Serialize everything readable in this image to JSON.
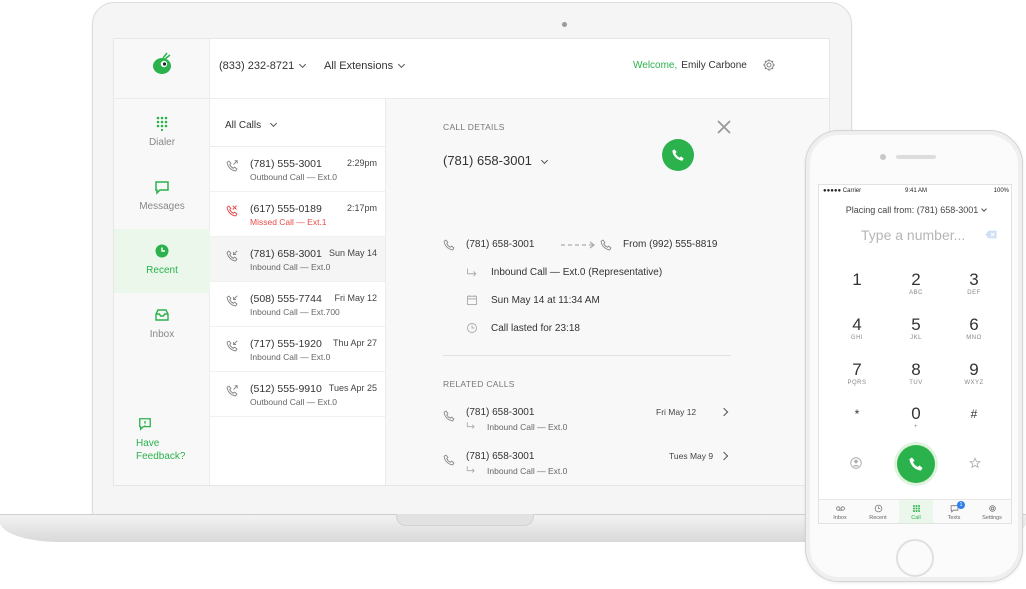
{
  "topbar": {
    "phone_number": "(833) 232-8721",
    "extensions": "All Extensions",
    "welcome": "Welcome,",
    "user": "Emily Carbone"
  },
  "nav": {
    "items": [
      {
        "label": "Dialer"
      },
      {
        "label": "Messages"
      },
      {
        "label": "Recent"
      },
      {
        "label": "Inbox"
      }
    ],
    "feedback_line1": "Have",
    "feedback_line2": "Feedback?"
  },
  "list": {
    "filter": "All Calls",
    "calls": [
      {
        "number": "(781) 555-3001",
        "date": "2:29pm",
        "sub": "Outbound Call — Ext.0",
        "type": "outbound"
      },
      {
        "number": "(617) 555-0189",
        "date": "2:17pm",
        "sub": "Missed Call — Ext.1",
        "type": "missed"
      },
      {
        "number": "(781) 658-3001",
        "date": "Sun May 14",
        "sub": "Inbound Call — Ext.0",
        "type": "inbound"
      },
      {
        "number": "(508) 555-7744",
        "date": "Fri May 12",
        "sub": "Inbound Call — Ext.700",
        "type": "inbound"
      },
      {
        "number": "(717) 555-1920",
        "date": "Thu Apr 27",
        "sub": "Inbound Call — Ext.0",
        "type": "inbound"
      },
      {
        "number": "(512) 555-9910",
        "date": "Tues Apr 25",
        "sub": "Outbound Call — Ext.0",
        "type": "outbound"
      }
    ]
  },
  "detail": {
    "label": "CALL DETAILS",
    "number": "(781) 658-3001",
    "from_number": "(781) 658-3001",
    "from_label": "From (992) 555-8819",
    "route": "Inbound Call — Ext.0 (Representative)",
    "datetime": "Sun May 14 at 11:34 AM",
    "duration": "Call lasted for 23:18",
    "related_label": "RELATED CALLS",
    "related": [
      {
        "number": "(781) 658-3001",
        "sub": "Inbound Call — Ext.0",
        "date": "Fri May 12"
      },
      {
        "number": "(781) 658-3001",
        "sub": "Inbound Call — Ext.0",
        "date": "Tues May 9"
      }
    ]
  },
  "phone": {
    "carrier": "●●●●● Carrier",
    "time": "9:41 AM",
    "battery": "100%",
    "placing": "Placing call from: (781) 658-3001",
    "placeholder": "Type a number...",
    "keys": [
      {
        "d": "1",
        "l": ""
      },
      {
        "d": "2",
        "l": "ABC"
      },
      {
        "d": "3",
        "l": "DEF"
      },
      {
        "d": "4",
        "l": "GHI"
      },
      {
        "d": "5",
        "l": "JKL"
      },
      {
        "d": "6",
        "l": "MNO"
      },
      {
        "d": "7",
        "l": "PQRS"
      },
      {
        "d": "8",
        "l": "TUV"
      },
      {
        "d": "9",
        "l": "WXYZ"
      },
      {
        "d": "*",
        "l": ""
      },
      {
        "d": "0",
        "l": "+"
      },
      {
        "d": "#",
        "l": ""
      }
    ],
    "tabs": [
      {
        "label": "Inbox"
      },
      {
        "label": "Recent"
      },
      {
        "label": "Call"
      },
      {
        "label": "Texts"
      },
      {
        "label": "Settings"
      }
    ],
    "texts_badge": "1"
  },
  "colors": {
    "accent": "#2bb24c",
    "missed": "#e84b4b",
    "badge": "#2f80ed"
  }
}
